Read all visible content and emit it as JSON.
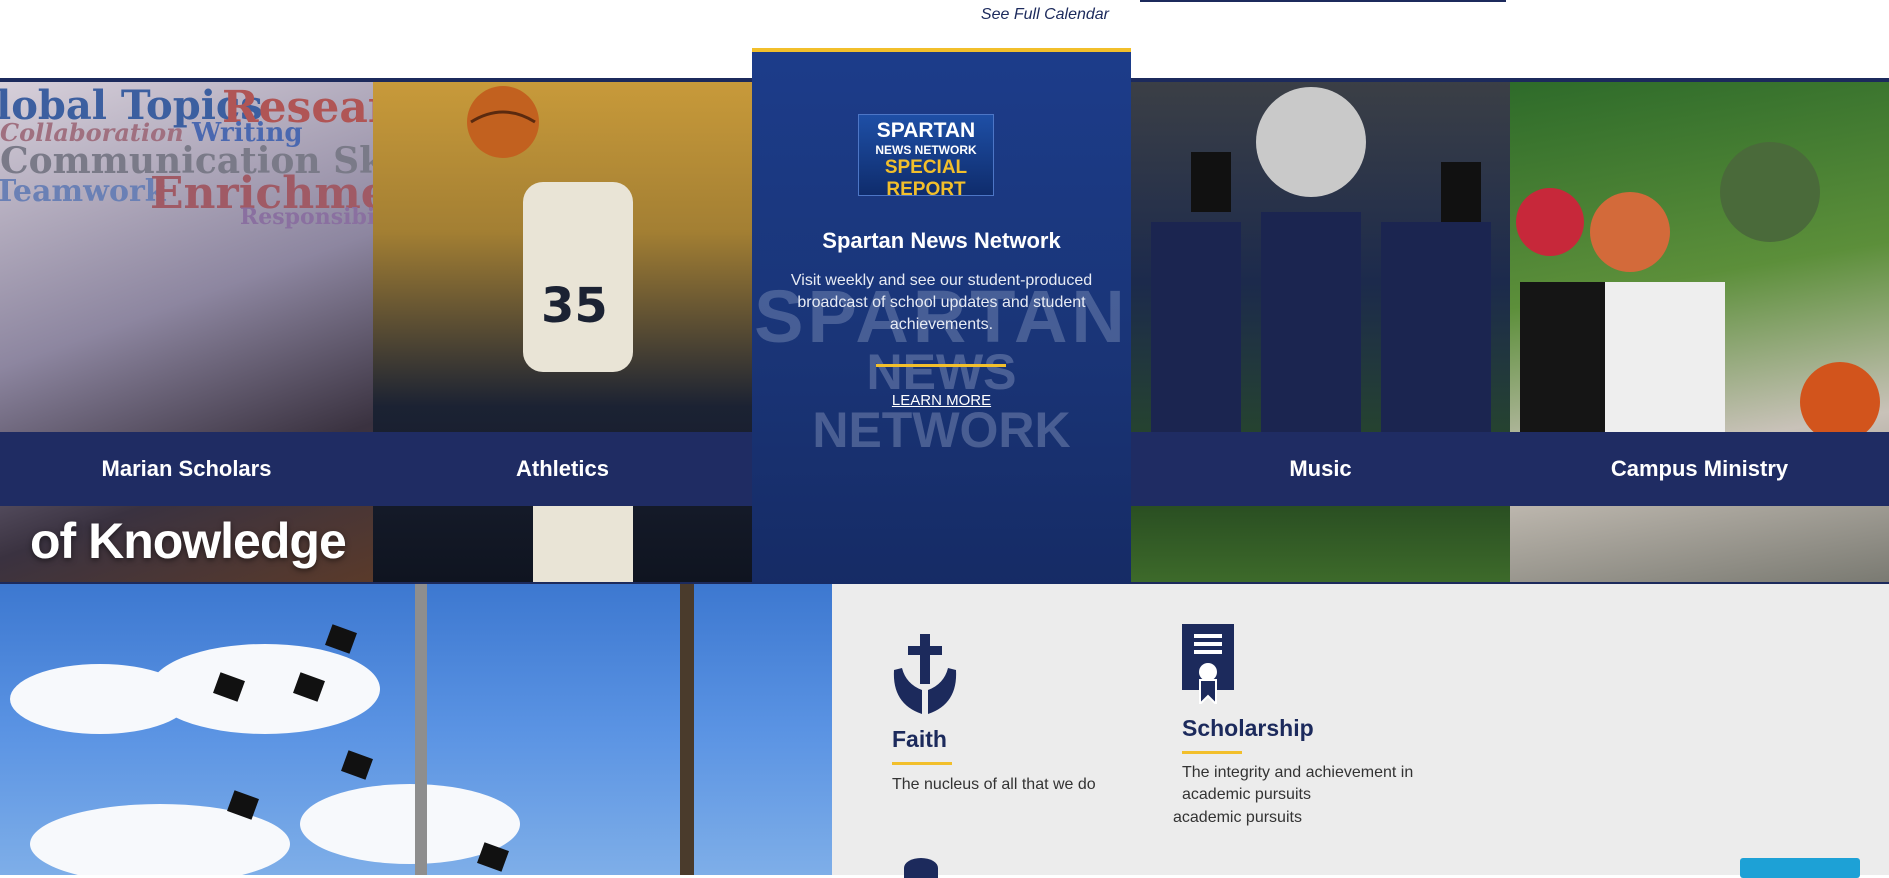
{
  "header": {
    "calendar_link": "See Full Calendar"
  },
  "tiles": [
    {
      "label": "Marian Scholars"
    },
    {
      "label": "Athletics"
    },
    {
      "label": "Music"
    },
    {
      "label": "Campus Ministry"
    }
  ],
  "marian_overlay": "of Knowledge",
  "wordcloud": [
    "lobal Topics",
    "Research",
    "Collaboration",
    "Writing",
    "Communication Skills",
    "Teamwork",
    "Enrichment",
    "Responsibility"
  ],
  "feature_card": {
    "logo_line1": "SPARTAN",
    "logo_line2": "NEWS NETWORK",
    "logo_line3": "SPECIAL REPORT",
    "title": "Spartan News Network",
    "description": "Visit weekly and see our student-produced broadcast of school updates and student achievements.",
    "bg_text1": "SPARTAN",
    "bg_text2": "NEWS NETWORK",
    "cta": "LEARN MORE"
  },
  "pillars": [
    {
      "icon": "cross-hands-icon",
      "title": "Faith",
      "description": "The nucleus of all that we do"
    },
    {
      "icon": "certificate-icon",
      "title": "Scholarship",
      "description": "The integrity and achievement in academic pursuits"
    }
  ],
  "stray_text": "academic pursuits",
  "colors": {
    "navy": "#1c2a5c",
    "gold": "#f2bf2b",
    "tile_bar": "#1f2c63"
  }
}
